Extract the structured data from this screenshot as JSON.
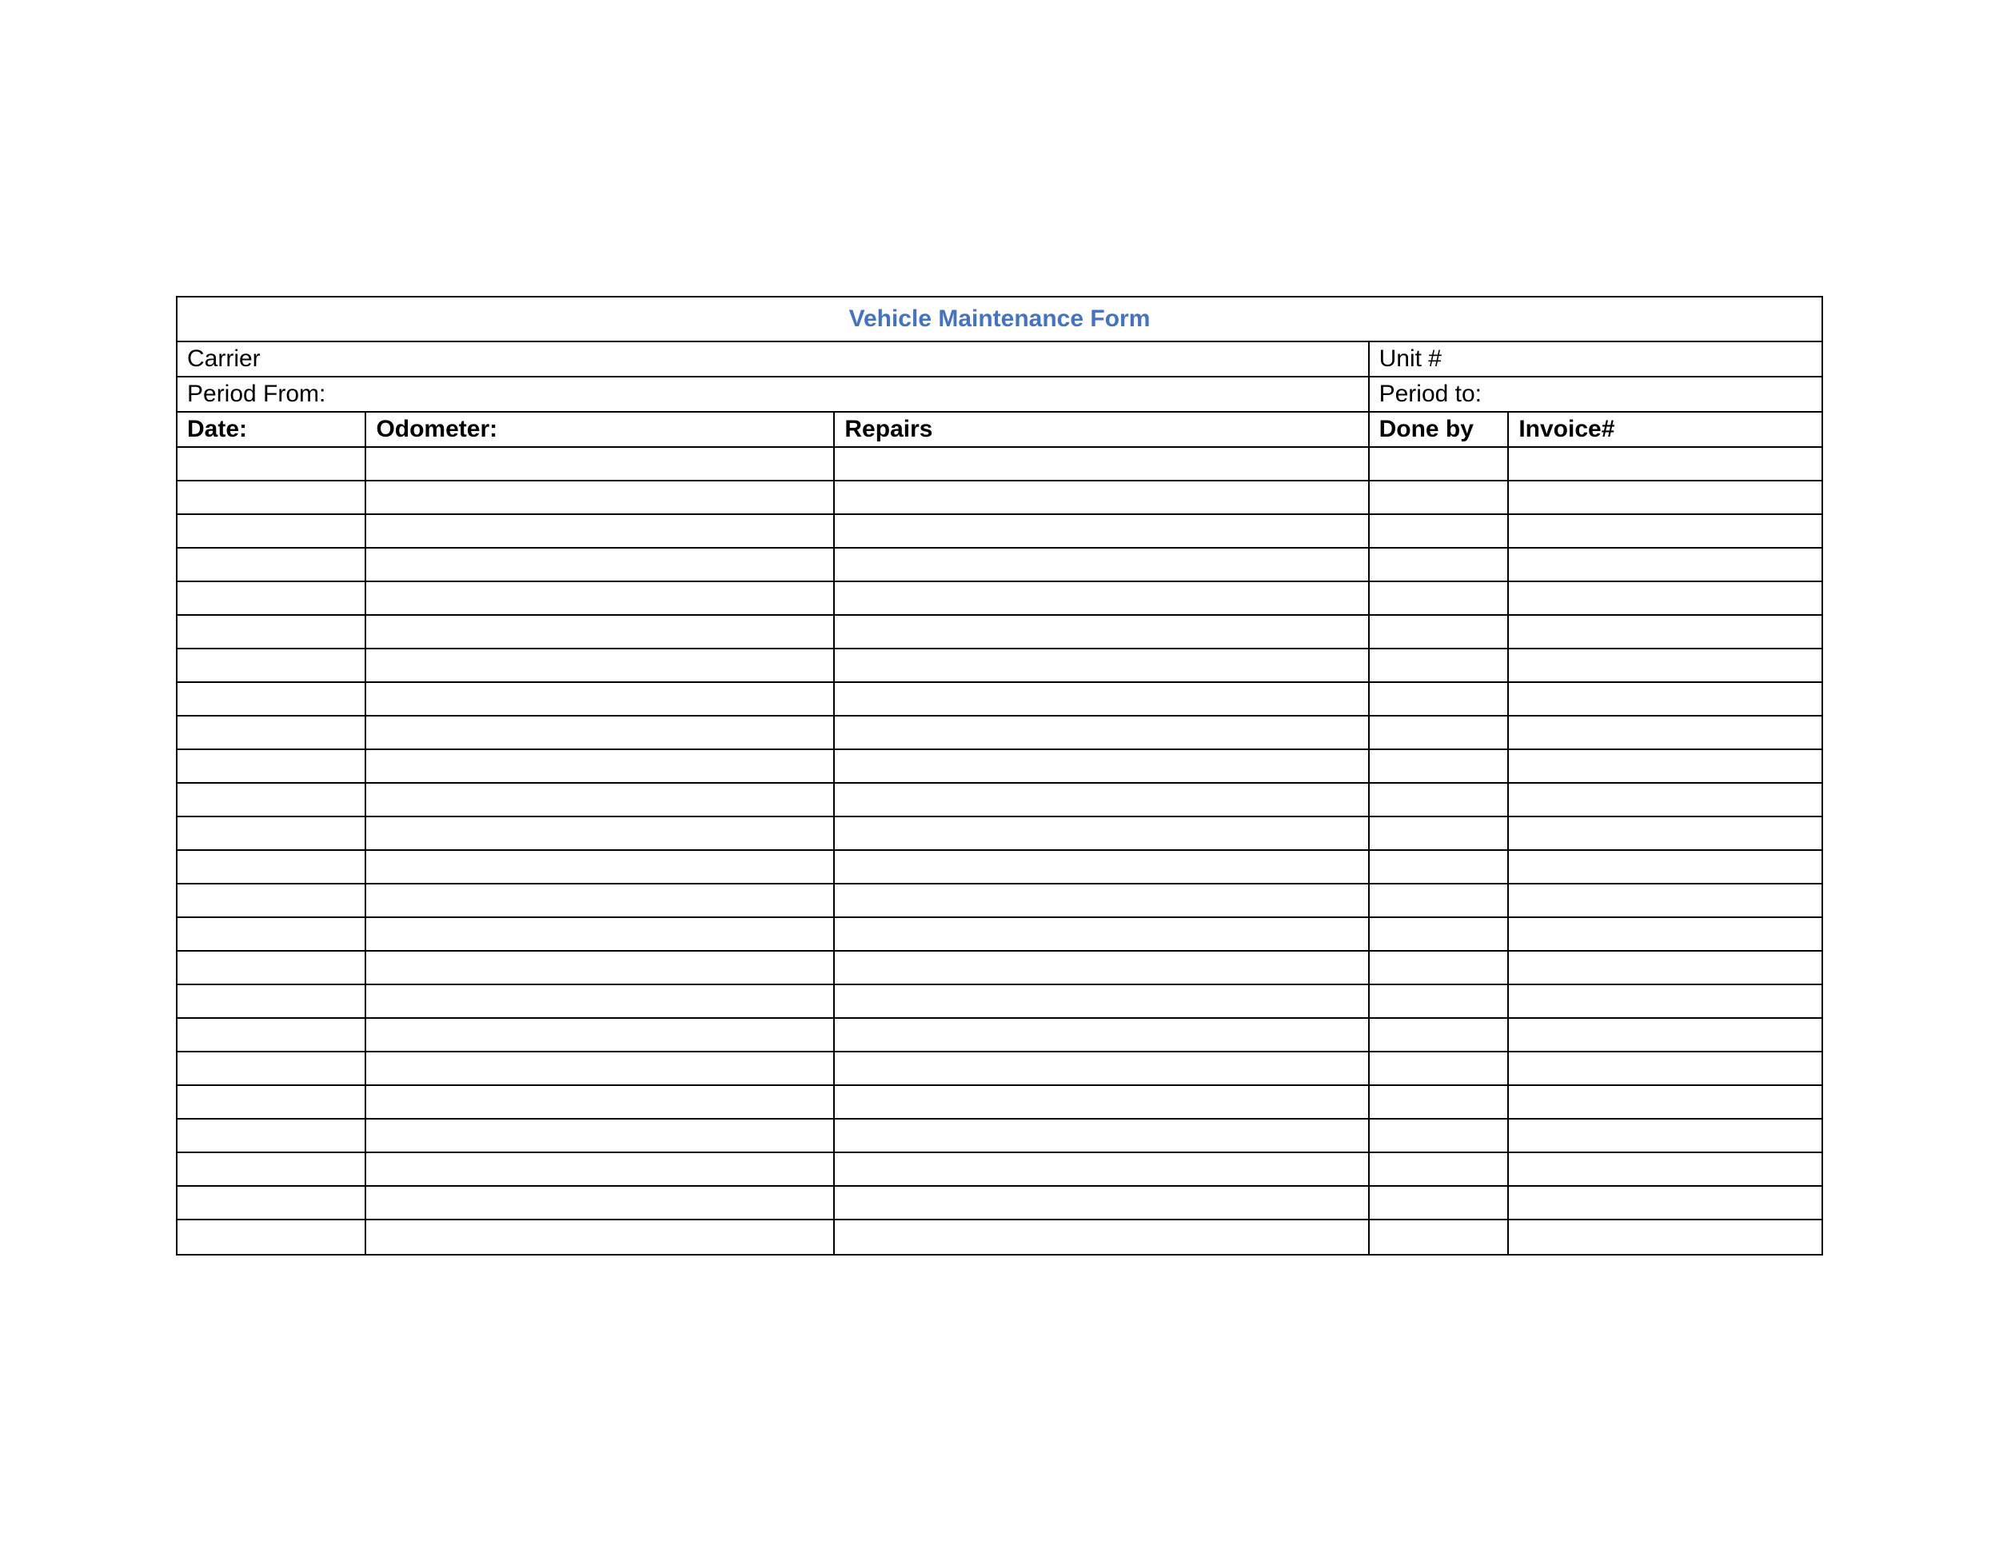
{
  "title": "Vehicle Maintenance Form",
  "fields": {
    "carrier_label": "Carrier",
    "unit_label": "Unit #",
    "period_from_label": "Period From:",
    "period_to_label": "Period to:"
  },
  "columns": {
    "date": "Date:",
    "odometer": "Odometer:",
    "repairs": "Repairs",
    "done_by": "Done by",
    "invoice": "Invoice#"
  },
  "row_count": 24
}
